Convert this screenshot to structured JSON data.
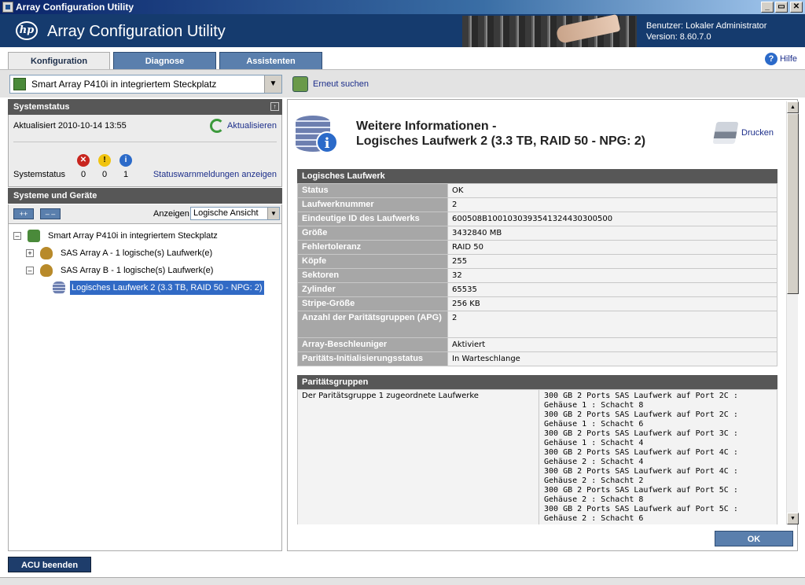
{
  "window": {
    "title": "Array Configuration Utility",
    "controls": [
      "_",
      "▭",
      "✕"
    ]
  },
  "header": {
    "logo": "hp",
    "title": "Array Configuration Utility",
    "user": "Benutzer: Lokaler Administrator",
    "version": "Version: 8.60.7.0"
  },
  "tabs": [
    {
      "label": "Konfiguration",
      "active": true
    },
    {
      "label": "Diagnose",
      "active": false
    },
    {
      "label": "Assistenten",
      "active": false
    }
  ],
  "help_label": "Hilfe",
  "controller_select": {
    "value": "Smart Array P410i in integriertem Steckplatz"
  },
  "rescan_label": "Erneut suchen",
  "system_status": {
    "title": "Systemstatus",
    "updated": "Aktualisiert 2010-10-14 13:55",
    "refresh": "Aktualisieren",
    "label": "Systemstatus",
    "counts": {
      "error": "0",
      "warning": "0",
      "info": "1"
    },
    "link": "Statuswarnmeldungen anzeigen"
  },
  "systems": {
    "title": "Systeme und Geräte",
    "expand_all": "++",
    "collapse_all": "– –",
    "view_label": "Anzeigen",
    "view_value": "Logische Ansicht",
    "tree": [
      {
        "label": "Smart Array P410i in integriertem Steckplatz",
        "expander": "–"
      },
      {
        "label": "SAS Array A - 1 logische(s) Laufwerk(e)",
        "expander": "+"
      },
      {
        "label": "SAS Array B - 1 logische(s) Laufwerk(e)",
        "expander": "–"
      },
      {
        "label": "Logisches Laufwerk 2 (3.3 TB, RAID 50 - NPG: 2)",
        "selected": true
      }
    ]
  },
  "exit_button": "ACU beenden",
  "content": {
    "title_line1": "Weitere Informationen -",
    "title_line2": "Logisches Laufwerk 2 (3.3 TB, RAID 50 - NPG: 2)",
    "print": "Drucken",
    "section1": "Logisches Laufwerk",
    "properties": [
      {
        "key": "Status",
        "value": "OK"
      },
      {
        "key": "Laufwerknummer",
        "value": "2"
      },
      {
        "key": "Eindeutige ID des Laufwerks",
        "value": "600508B1001030393541324430300500"
      },
      {
        "key": "Größe",
        "value": "3432840 MB"
      },
      {
        "key": "Fehlertoleranz",
        "value": "RAID 50"
      },
      {
        "key": "Köpfe",
        "value": "255"
      },
      {
        "key": "Sektoren",
        "value": "32"
      },
      {
        "key": "Zylinder",
        "value": "65535"
      },
      {
        "key": "Stripe-Größe",
        "value": "256 KB"
      },
      {
        "key": "Anzahl der Paritätsgruppen (APG)",
        "value": "2"
      },
      {
        "key": "Array-Beschleuniger",
        "value": "Aktiviert"
      },
      {
        "key": "Paritäts-Initialisierungsstatus",
        "value": "In Warteschlange"
      }
    ],
    "section2": "Paritätsgruppen",
    "parity_group_label": "Der Paritätsgruppe 1 zugeordnete Laufwerke",
    "parity_drives": [
      "300 GB 2 Ports SAS Laufwerk auf Port 2C : Gehäuse 1 : Schacht 8",
      "300 GB 2 Ports SAS Laufwerk auf Port 2C : Gehäuse 1 : Schacht 6",
      "300 GB 2 Ports SAS Laufwerk auf Port 3C : Gehäuse 1 : Schacht 4",
      "300 GB 2 Ports SAS Laufwerk auf Port 4C : Gehäuse 2 : Schacht 4",
      "300 GB 2 Ports SAS Laufwerk auf Port 4C : Gehäuse 2 : Schacht 2",
      "300 GB 2 Ports SAS Laufwerk auf Port 5C : Gehäuse 2 : Schacht 8",
      "300 GB 2 Ports SAS Laufwerk auf Port 5C : Gehäuse 2 : Schacht 6"
    ],
    "ok": "OK"
  },
  "colors": {
    "header_bg": "#153b6e",
    "tab_bg": "#5a7fad",
    "panel_header": "#575757",
    "link": "#1c2e8a",
    "selection": "#316ac5"
  }
}
